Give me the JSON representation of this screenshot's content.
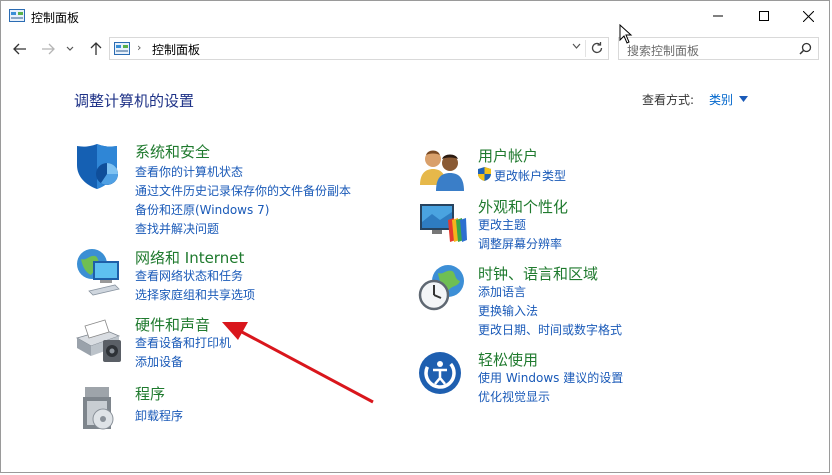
{
  "window": {
    "title": "控制面板"
  },
  "nav": {
    "breadcrumb": "控制面板",
    "breadcrumb_sep": "›",
    "search_placeholder": "搜索控制面板"
  },
  "content": {
    "heading": "调整计算机的设置",
    "view_by_label": "查看方式:",
    "view_by_value": "类别"
  },
  "categories": {
    "system": {
      "title": "系统和安全",
      "links": [
        "查看你的计算机状态",
        "通过文件历史记录保存你的文件备份副本",
        "备份和还原(Windows 7)",
        "查找并解决问题"
      ]
    },
    "network": {
      "title": "网络和 Internet",
      "links": [
        "查看网络状态和任务",
        "选择家庭组和共享选项"
      ]
    },
    "hardware": {
      "title": "硬件和声音",
      "links": [
        "查看设备和打印机",
        "添加设备"
      ]
    },
    "programs": {
      "title": "程序",
      "links": [
        "卸载程序"
      ]
    },
    "accounts": {
      "title": "用户帐户",
      "links": [
        "更改帐户类型"
      ]
    },
    "appearance": {
      "title": "外观和个性化",
      "links": [
        "更改主题",
        "调整屏幕分辨率"
      ]
    },
    "clock": {
      "title": "时钟、语言和区域",
      "links": [
        "添加语言",
        "更换输入法",
        "更改日期、时间或数字格式"
      ]
    },
    "ease": {
      "title": "轻松使用",
      "links": [
        "使用 Windows 建议的设置",
        "优化视觉显示"
      ]
    }
  },
  "colors": {
    "heading": "#1e3287",
    "category_title": "#1f7a2e",
    "link": "#1a5ab8",
    "annotation_arrow": "#d9161c"
  }
}
